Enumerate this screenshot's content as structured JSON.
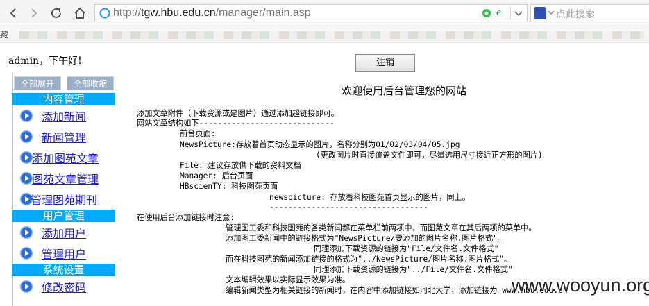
{
  "browser": {
    "url_prefix": "http://",
    "url_domain": "tgw.hbu.edu.cn",
    "url_path": "/manager/main.asp",
    "search_placeholder": "点此搜索",
    "bookmarks_label": "藏"
  },
  "left": {
    "greeting": "admin，下午好!",
    "expand_all": "全部展开",
    "collapse_all": "全部收缩",
    "sections": [
      {
        "title": "内容管理",
        "items": [
          "添加新闻",
          "新闻管理",
          "添加图苑文章",
          "图苑文章管理",
          "管理图苑期刊"
        ]
      },
      {
        "title": "用户管理",
        "items": [
          "添加用户",
          "管理用户"
        ]
      },
      {
        "title": "系统设置",
        "items": [
          "修改密码"
        ]
      }
    ]
  },
  "main": {
    "logout_label": "注销",
    "welcome": "欢迎使用后台管理您的网站",
    "lines": [
      "添加文章附件（下载资源或是图片）通过添加超链接即可。",
      "网站文章结构如下-----------------------------",
      "前台页面:",
      "NewsPicture:存放着首页动态显示的图片，名称分别为01/02/03/04/05.jpg",
      "(更改图片时直接覆盖文件即可，尽量选用尺寸接近正方形的图片)",
      "File: 建议存放供下载的资料文档",
      "Manager: 后台页面",
      "HBscienTY: 科技图苑页面",
      "newspicture: 存放着科技图苑首页显示的图片，同上。",
      "----------------------------------",
      "在使用后台添加链接时注意:",
      "管理图工委和科技图苑的各类新闻都在菜单栏前两项中，而图苑文章在其后两项的菜单中。",
      "添加图工委新闻中的链接格式为\"NewsPicture/要添加的图片名称.图片格式\"。",
      "同理添加下载资源的链接为\"File/文件名.文件格式\"",
      "而在科技图苑的新闻添加链接的格式为\"../NewsPicture/图片名称.图片格式\"。",
      "同理添加下载资源的链接为\"../File/文件名.文件格式\"",
      "文本编辑效果以实际显示效果为准。",
      "编辑新闻类型为相关链接的新闻时，在内容中添加链接如河北大学，添加链接为 www.hbu.edu.cn"
    ]
  },
  "watermark": "www.wooyun.org",
  "colors": {
    "section_bg": "#00aaff",
    "link": "#1a1aee",
    "toggle_bg": "#9cb0ca"
  }
}
